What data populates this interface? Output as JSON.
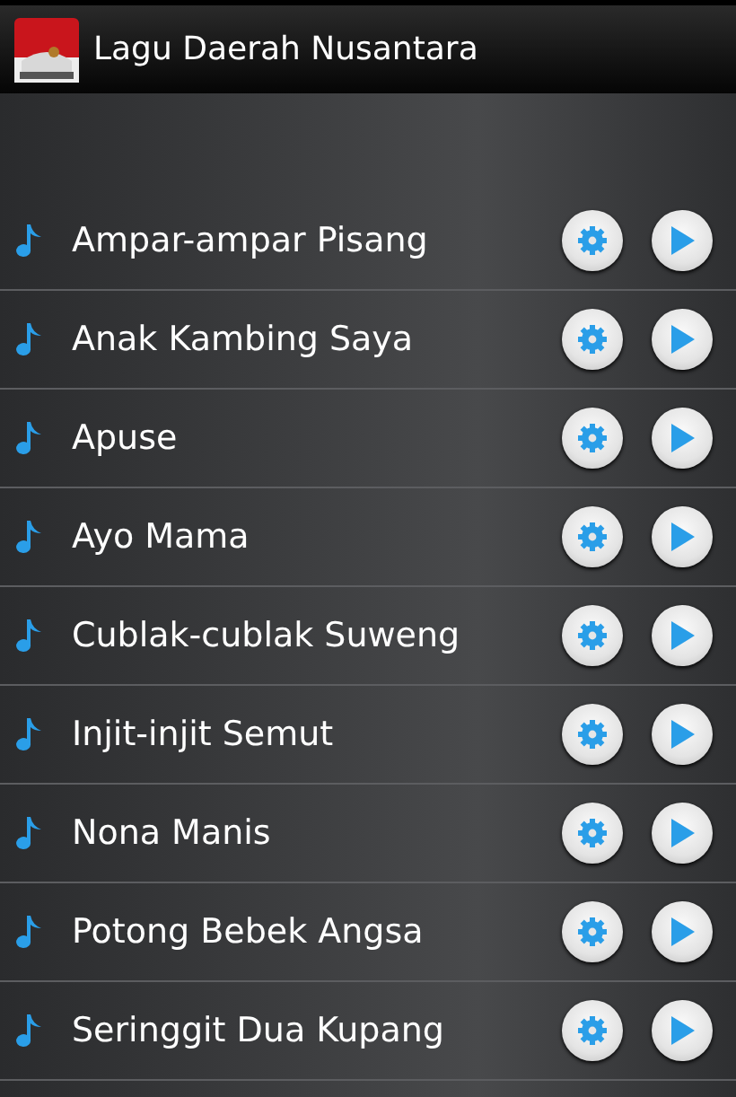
{
  "window": {
    "title": "Lagu Daerah Nusantara"
  },
  "songs": [
    {
      "title": "Ampar-ampar Pisang"
    },
    {
      "title": "Anak Kambing Saya"
    },
    {
      "title": "Apuse"
    },
    {
      "title": "Ayo Mama"
    },
    {
      "title": "Cublak-cublak Suweng"
    },
    {
      "title": "Injit-injit Semut"
    },
    {
      "title": "Nona Manis"
    },
    {
      "title": "Potong Bebek Angsa"
    },
    {
      "title": "Seringgit Dua Kupang"
    }
  ]
}
